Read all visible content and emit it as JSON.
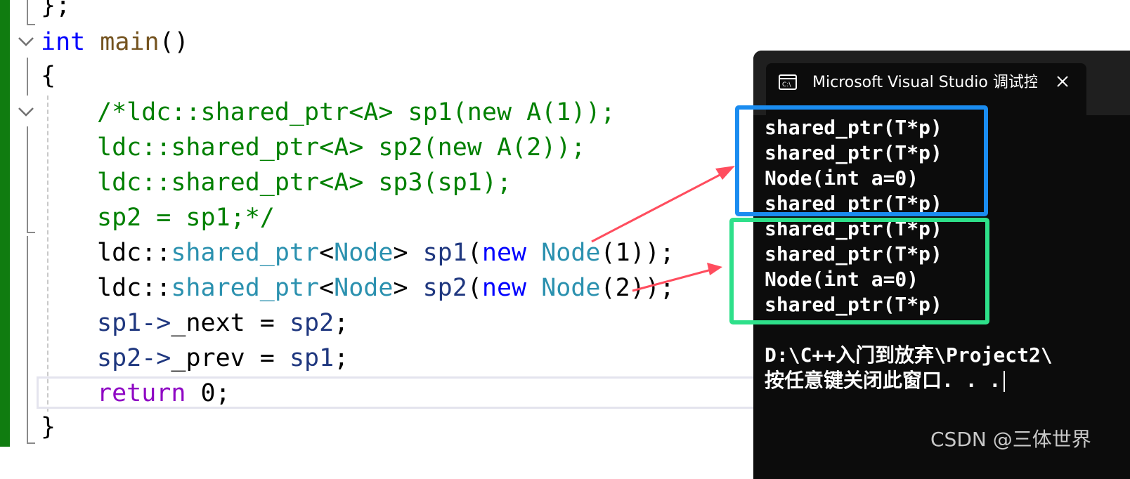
{
  "editor": {
    "lines": [
      {
        "id": "close-brace-semicolon",
        "tokens": [
          {
            "t": "};",
            "c": "plain"
          }
        ]
      },
      {
        "id": "main-signature",
        "tokens": [
          {
            "t": "int",
            "c": "kw"
          },
          {
            "t": " ",
            "c": "plain"
          },
          {
            "t": "main",
            "c": "fn"
          },
          {
            "t": "()",
            "c": "plain"
          }
        ]
      },
      {
        "id": "main-open-brace",
        "tokens": [
          {
            "t": "{",
            "c": "plain"
          }
        ]
      },
      {
        "id": "comment-line-1",
        "tokens": [
          {
            "t": "/*ldc::shared_ptr<A> sp1(new A(1));",
            "c": "cmt"
          }
        ]
      },
      {
        "id": "comment-line-2",
        "tokens": [
          {
            "t": "ldc::shared_ptr<A> sp2(new A(2));",
            "c": "cmt"
          }
        ]
      },
      {
        "id": "comment-line-3",
        "tokens": [
          {
            "t": "ldc::shared_ptr<A> sp3(sp1);",
            "c": "cmt"
          }
        ]
      },
      {
        "id": "comment-line-4",
        "tokens": [
          {
            "t": "sp2 = sp1;*/",
            "c": "cmt"
          }
        ]
      },
      {
        "id": "decl-sp1",
        "tokens": [
          {
            "t": "ldc::",
            "c": "plain"
          },
          {
            "t": "shared_ptr",
            "c": "type"
          },
          {
            "t": "<",
            "c": "plain"
          },
          {
            "t": "Node",
            "c": "type"
          },
          {
            "t": "> ",
            "c": "plain"
          },
          {
            "t": "sp1",
            "c": "var"
          },
          {
            "t": "(",
            "c": "plain"
          },
          {
            "t": "new",
            "c": "kw"
          },
          {
            "t": " ",
            "c": "plain"
          },
          {
            "t": "Node",
            "c": "type"
          },
          {
            "t": "(1));",
            "c": "plain"
          }
        ]
      },
      {
        "id": "decl-sp2",
        "tokens": [
          {
            "t": "ldc::",
            "c": "plain"
          },
          {
            "t": "shared_ptr",
            "c": "type"
          },
          {
            "t": "<",
            "c": "plain"
          },
          {
            "t": "Node",
            "c": "type"
          },
          {
            "t": "> ",
            "c": "plain"
          },
          {
            "t": "sp2",
            "c": "var"
          },
          {
            "t": "(",
            "c": "plain"
          },
          {
            "t": "new",
            "c": "kw"
          },
          {
            "t": " ",
            "c": "plain"
          },
          {
            "t": "Node",
            "c": "type"
          },
          {
            "t": "(2));",
            "c": "plain"
          }
        ]
      },
      {
        "id": "assign-next",
        "tokens": [
          {
            "t": "sp1",
            "c": "var"
          },
          {
            "t": "->",
            "c": "var"
          },
          {
            "t": "_next",
            "c": "plain"
          },
          {
            "t": " = ",
            "c": "plain"
          },
          {
            "t": "sp2",
            "c": "var"
          },
          {
            "t": ";",
            "c": "plain"
          }
        ]
      },
      {
        "id": "assign-prev",
        "tokens": [
          {
            "t": "sp2",
            "c": "var"
          },
          {
            "t": "->",
            "c": "var"
          },
          {
            "t": "_prev",
            "c": "plain"
          },
          {
            "t": " = ",
            "c": "plain"
          },
          {
            "t": "sp1",
            "c": "var"
          },
          {
            "t": ";",
            "c": "plain"
          }
        ]
      },
      {
        "id": "return-stmt",
        "tokens": [
          {
            "t": "return",
            "c": "kw-ret"
          },
          {
            "t": " 0;",
            "c": "plain"
          }
        ]
      },
      {
        "id": "main-close-brace",
        "tokens": [
          {
            "t": "}",
            "c": "plain"
          }
        ]
      }
    ]
  },
  "console": {
    "title": "Microsoft Visual Studio 调试控制台",
    "icon": "console-app-icon",
    "close_icon": "close-icon",
    "output": [
      "shared_ptr(T*p)",
      "shared_ptr(T*p)",
      "Node(int a=0)",
      "shared_ptr(T*p)",
      "shared_ptr(T*p)",
      "shared_ptr(T*p)",
      "Node(int a=0)",
      "shared_ptr(T*p)",
      "",
      "D:\\C++入门到放弃\\Project2\\",
      "按任意键关闭此窗口. . ."
    ]
  },
  "annotations": {
    "blue_box_color": "#1a8cf0",
    "green_box_color": "#2ee08a",
    "arrow_color": "#ff4d5e"
  },
  "watermark": "CSDN @三体世界"
}
